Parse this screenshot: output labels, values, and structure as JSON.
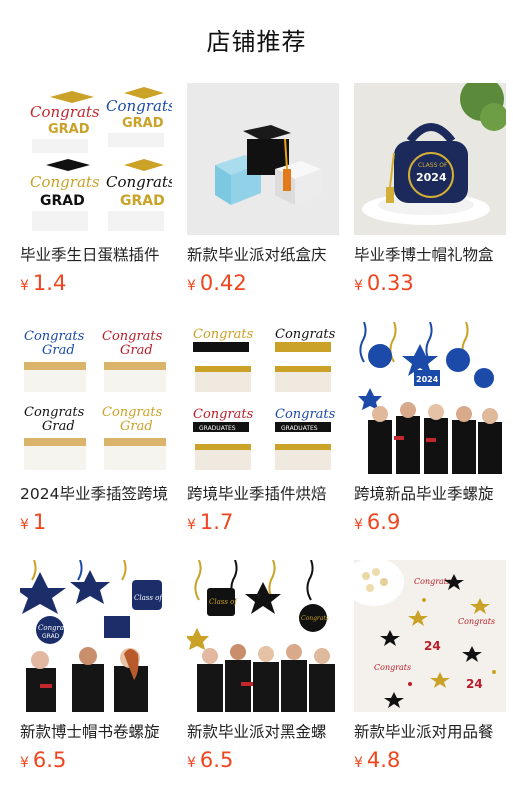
{
  "section_title": "店铺推荐",
  "currency_symbol": "¥",
  "accent_color": "#f0451e",
  "products": [
    {
      "name": "毕业季生日蛋糕插件",
      "price": "1.4",
      "image_text": [
        "Congrats",
        "GRAD"
      ]
    },
    {
      "name": "新款毕业派对纸盒庆",
      "price": "0.42",
      "image_text": []
    },
    {
      "name": "毕业季博士帽礼物盒",
      "price": "0.33",
      "image_text": [
        "2024",
        "CLASS OF"
      ]
    },
    {
      "name": "2024毕业季插签跨境",
      "price": "1",
      "image_text": [
        "Congrats",
        "Grad"
      ]
    },
    {
      "name": "跨境毕业季插件烘焙",
      "price": "1.7",
      "image_text": [
        "Congrats",
        "GRADUATES"
      ]
    },
    {
      "name": "跨境新品毕业季螺旋",
      "price": "6.9",
      "image_text": [
        "2024"
      ]
    },
    {
      "name": "新款博士帽书卷螺旋",
      "price": "6.5",
      "image_text": [
        "Congrats",
        "GRAD",
        "Class of"
      ]
    },
    {
      "name": "新款毕业派对黑金螺",
      "price": "6.5",
      "image_text": [
        "Class of",
        "Congrats"
      ]
    },
    {
      "name": "新款毕业派对用品餐",
      "price": "4.8",
      "image_text": [
        "Congrats"
      ]
    }
  ]
}
